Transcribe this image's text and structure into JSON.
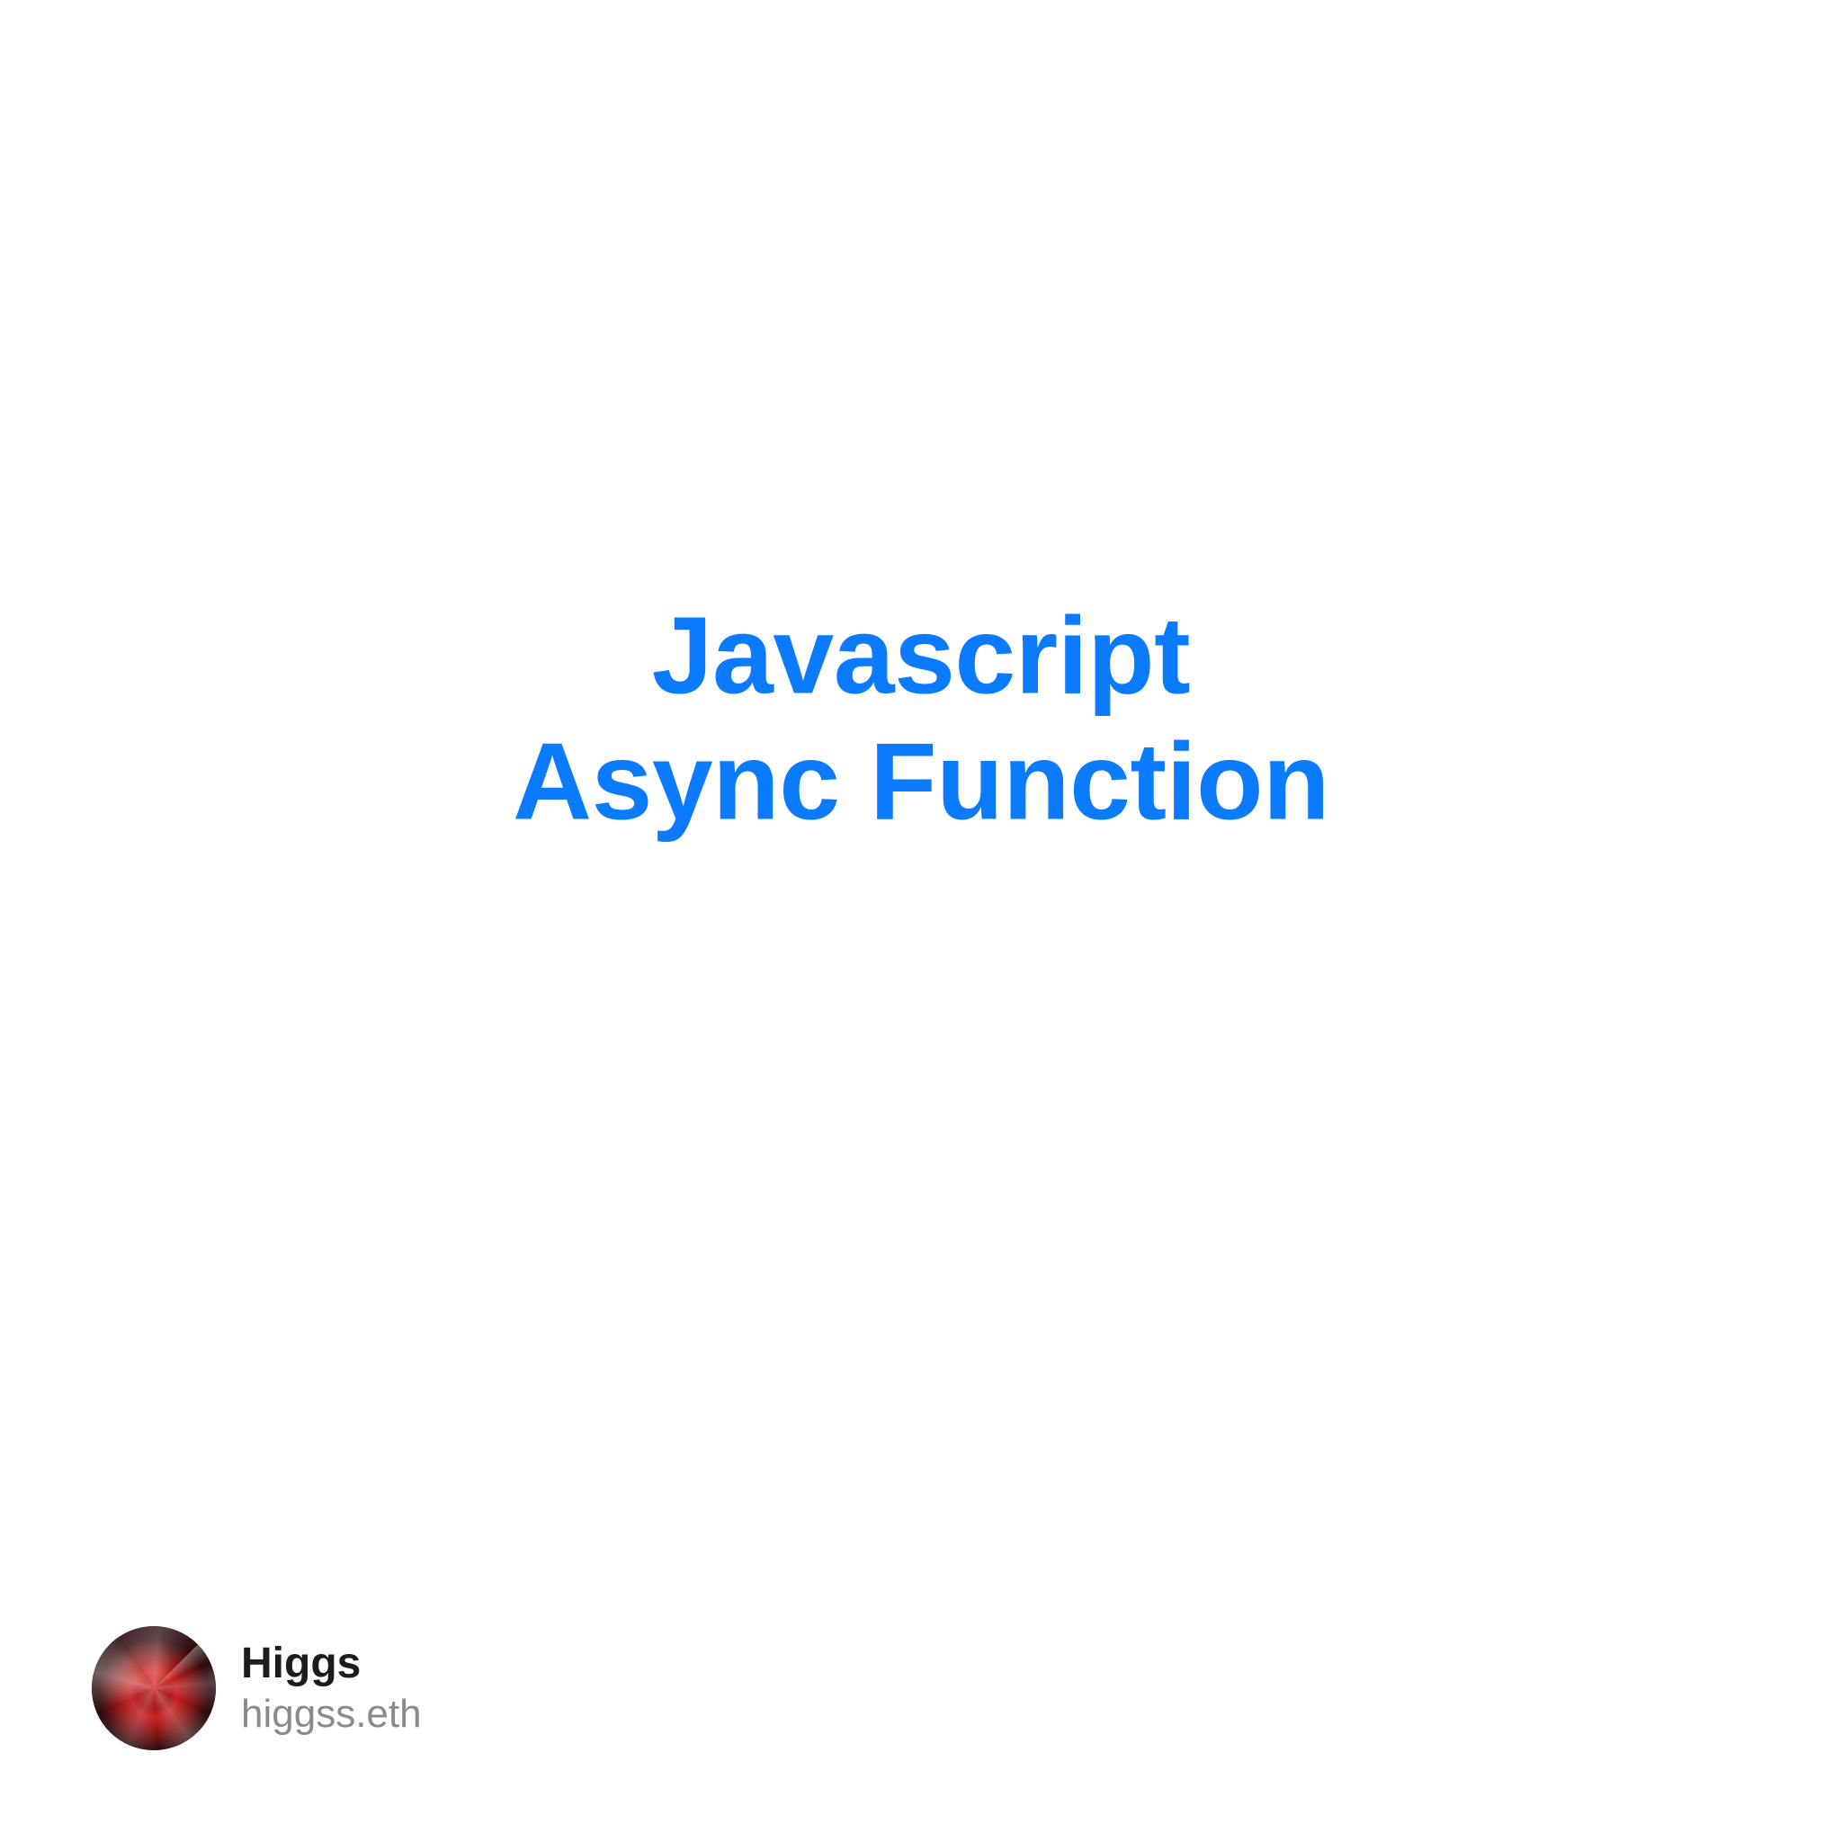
{
  "title": {
    "line1": "Javascript",
    "line2": "Async Function"
  },
  "author": {
    "name": "Higgs",
    "handle": "higgss.eth"
  },
  "colors": {
    "title": "#0a7aff",
    "text_primary": "#1c1c1e",
    "text_secondary": "#8a8a8e"
  }
}
